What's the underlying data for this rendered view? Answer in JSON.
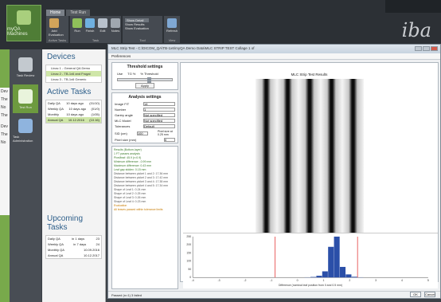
{
  "window": {
    "title": "IBA myQA"
  },
  "ribbon": {
    "app_button": "myQA Machines",
    "tabs": [
      "Home",
      "Test Run"
    ],
    "groups": [
      {
        "label": "Active Tasks",
        "buttons": [
          "Add Evaluation"
        ]
      },
      {
        "label": "Task",
        "buttons": [
          "Run",
          "Finish",
          "Edit",
          "Notes"
        ]
      },
      {
        "label": "Tool",
        "buttons": [
          "Show Detail",
          "Show Results",
          "Show Evaluation"
        ]
      },
      {
        "label": "View",
        "buttons": [
          "Refresh"
        ]
      }
    ],
    "logo": "iba"
  },
  "left_nav": {
    "items": [
      {
        "label": "Task Review",
        "active": false
      },
      {
        "label": "Test Run",
        "active": true
      },
      {
        "label": "Task Administration",
        "active": false
      }
    ]
  },
  "partial_left": {
    "lines": [
      "Dev",
      "The",
      "No",
      "The",
      "",
      "Dev",
      "The",
      "No"
    ]
  },
  "devices": {
    "title": "Devices",
    "rows": [
      {
        "name": "Linac 1 - General QA Demo",
        "badge": "",
        "sel": false
      },
      {
        "name": "Linac 2 - TB-1x6 and Frugal",
        "badge": "",
        "sel": true
      },
      {
        "name": "Linac 3 - TB-1x6 Generic",
        "badge": "",
        "sel": false
      }
    ]
  },
  "active_tasks": {
    "title": "Active Tasks",
    "rows": [
      {
        "name": "Daily QA",
        "due": "10 days ago",
        "date": "(01/10)",
        "sel": false
      },
      {
        "name": "Weekly QA",
        "due": "10 days ago",
        "date": "(01/0)",
        "sel": false
      },
      {
        "name": "Monthly",
        "due": "10 days ago",
        "date": "(1/05)",
        "sel": false
      },
      {
        "name": "Annual QA",
        "due": "10.12.2016",
        "date": "(10.16)",
        "sel": true
      }
    ]
  },
  "upcoming_tasks": {
    "title": "Upcoming Tasks",
    "rows": [
      {
        "name": "Daily QA",
        "due": "in 1 days",
        "date": "23"
      },
      {
        "name": "Weekly QA",
        "due": "in 7 days",
        "date": "24"
      },
      {
        "name": "Monthly QA",
        "due": "10.09.2016",
        "date": ""
      },
      {
        "name": "Annual QA",
        "due": "10.12.2017",
        "date": ""
      }
    ]
  },
  "dialog": {
    "title": "MLC Strip Test - C:\\DICOM_QA\\TB-1x6\\myQA Demo Data\\MLC STRIP TEST Collage 1 of",
    "menu": "Preferences",
    "threshold": {
      "title": "Threshold settings",
      "options": [
        "Use",
        "TG %",
        "% Threshold"
      ],
      "apply_button": "Apply"
    },
    "analysis": {
      "title": "Analysis settings",
      "fields": [
        {
          "label": "Image FIT",
          "value": "14"
        },
        {
          "label": "Number",
          "value": "1"
        },
        {
          "label": "Gantry angle",
          "value": "Not specified"
        },
        {
          "label": "MLC Model",
          "value": "Not specified"
        },
        {
          "label": "Tolerances",
          "value": "Default"
        },
        {
          "label": "SID (cm)",
          "value": "100"
        },
        {
          "label": "Pixel size (mm)",
          "value": "0"
        }
      ],
      "pixel_note": "Pixel size at 0.25 mm"
    },
    "results": {
      "header": "Results (Bottom-layer)",
      "lines": [
        "",
        "1 FT passes analysis",
        "Pixel/leaf: 45.9 (r=0.9)",
        "Minimum difference: -0.99 mm",
        "Maximum difference: 0.43 mm",
        "Leaf gap stddev: 0.15 mm",
        "",
        "Distance between picket 1 and 2: 17.36 mm",
        "Distance between picket 2 and 3: 17.42 mm",
        "Distance between picket 3 and 4: 17.38 mm",
        "Distance between picket 4 and 5: 17.34 mm",
        "",
        "Shape of Leaf 1: 0.24 mm",
        "Shape of Leaf 2: 0.25 mm",
        "Shape of Leaf 3: 0.26 mm",
        "Shape of Leaf 4: 0.23 mm",
        "",
        "Evaluation",
        "All leaves passed within tolerance limits"
      ]
    },
    "plot": {
      "title": "MLC Strip Test Results",
      "stripe_count": 5
    },
    "histogram": {
      "xlabel": "Difference (nominal leaf position from 0 and 0.5 mm)",
      "ylabel": "",
      "bins": [
        0,
        0,
        0,
        0,
        0,
        0,
        0,
        0,
        0,
        0,
        0,
        0,
        0,
        0,
        0,
        0,
        0,
        0,
        0,
        1,
        3,
        10,
        36,
        180,
        240,
        62,
        18,
        4,
        1,
        0,
        0,
        0,
        0,
        0,
        0,
        0,
        0,
        0,
        0,
        0
      ],
      "xticks": [
        "-4",
        "-3",
        "-2",
        "-1",
        "0",
        "1",
        "2",
        "3",
        "4",
        "5"
      ],
      "yticks": [
        "0",
        "50",
        "100",
        "150",
        "200",
        "250"
      ]
    },
    "status_left": "Passed (n=1) 3 failed",
    "buttons": [
      "OK",
      "Cancel"
    ]
  },
  "colors": {
    "ribbon": "#2c3035",
    "nav_active": "#6d9a3f",
    "accent_blue": "#2e5f8a",
    "hist_bar": "#2b4fa8",
    "hist_limit": "#e02020"
  }
}
